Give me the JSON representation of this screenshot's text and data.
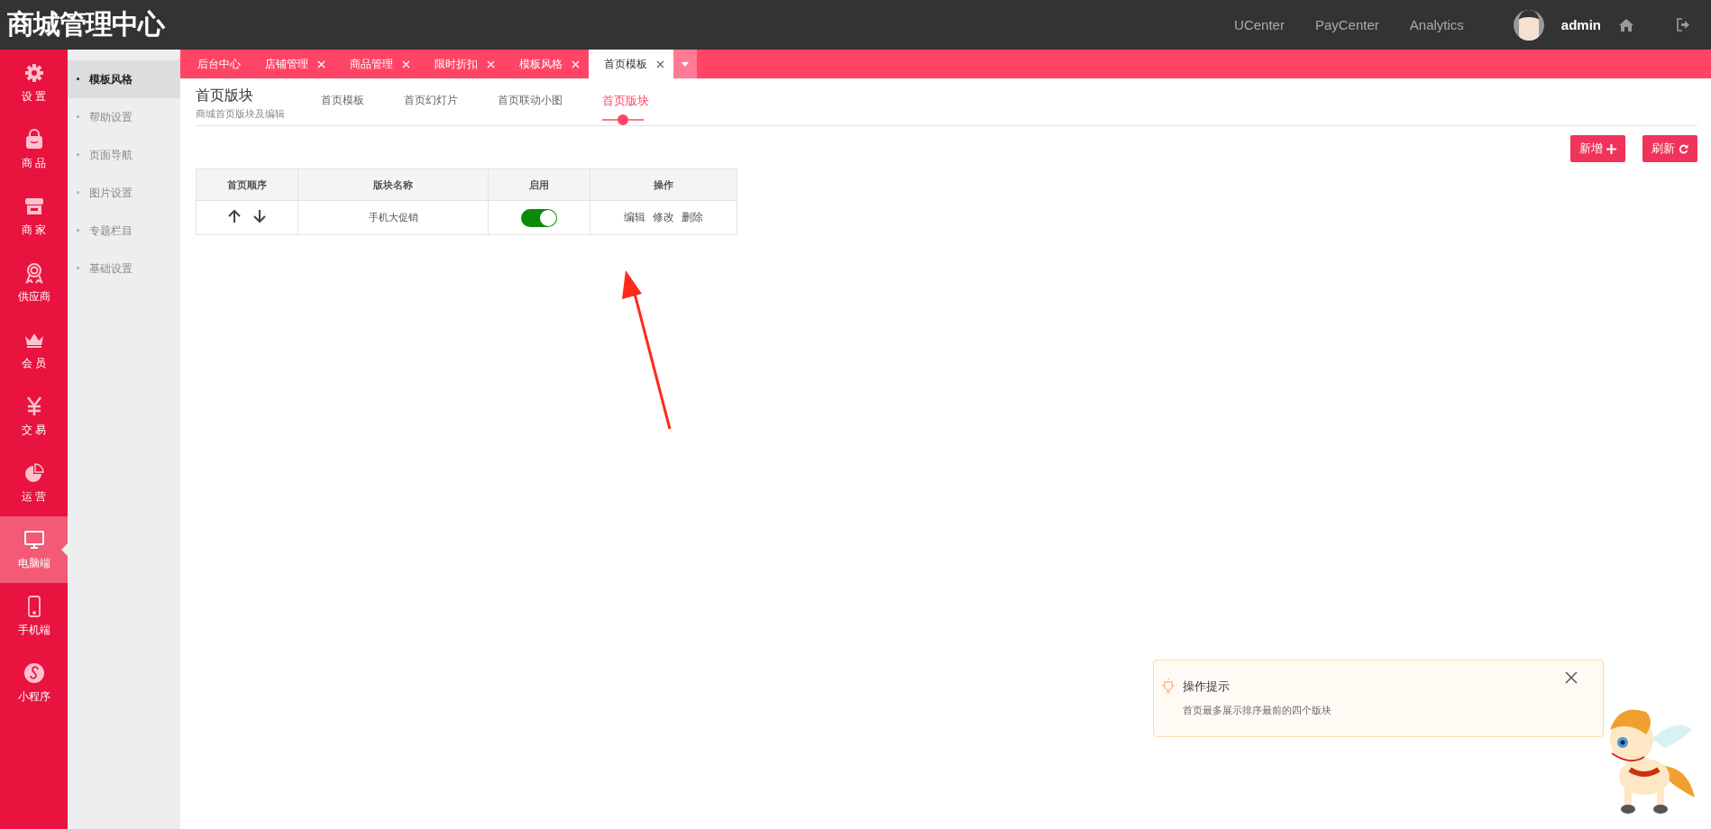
{
  "header": {
    "title": "商城管理中心",
    "links": [
      "UCenter",
      "PayCenter",
      "Analytics"
    ],
    "user": "admin"
  },
  "rail": [
    {
      "label": "设 置",
      "selected": false
    },
    {
      "label": "商 品",
      "selected": false
    },
    {
      "label": "商 家",
      "selected": false
    },
    {
      "label": "供应商",
      "selected": false
    },
    {
      "label": "会 员",
      "selected": false
    },
    {
      "label": "交 易",
      "selected": false
    },
    {
      "label": "运 营",
      "selected": false
    },
    {
      "label": "电脑端",
      "selected": true
    },
    {
      "label": "手机端",
      "selected": false
    },
    {
      "label": "小程序",
      "selected": false
    }
  ],
  "submenu": [
    {
      "label": "模板风格",
      "selected": true
    },
    {
      "label": "帮助设置",
      "selected": false
    },
    {
      "label": "页面导航",
      "selected": false
    },
    {
      "label": "图片设置",
      "selected": false
    },
    {
      "label": "专题栏目",
      "selected": false
    },
    {
      "label": "基础设置",
      "selected": false
    }
  ],
  "tabs": [
    {
      "label": "后台中心",
      "closable": false,
      "selected": false
    },
    {
      "label": "店铺管理",
      "closable": true,
      "selected": false
    },
    {
      "label": "商品管理",
      "closable": true,
      "selected": false
    },
    {
      "label": "限时折扣",
      "closable": true,
      "selected": false
    },
    {
      "label": "模板风格",
      "closable": true,
      "selected": false
    },
    {
      "label": "首页模板",
      "closable": true,
      "selected": true
    }
  ],
  "page": {
    "title": "首页版块",
    "subtitle": "商城首页版块及编辑",
    "subtabs": [
      {
        "label": "首页模板",
        "selected": false
      },
      {
        "label": "首页幻灯片",
        "selected": false
      },
      {
        "label": "首页联动小图",
        "selected": false
      },
      {
        "label": "首页版块",
        "selected": true
      }
    ],
    "buttons": [
      "新增",
      "刷新"
    ]
  },
  "table": {
    "columns": [
      "首页顺序",
      "版块名称",
      "启用",
      "操作"
    ],
    "rows": [
      {
        "name": "手机大促销",
        "enabled": true,
        "actions": [
          "编辑",
          "修改",
          "删除"
        ]
      }
    ]
  },
  "tip": {
    "title": "操作提示",
    "text": "首页最多展示排序最前的四个版块"
  }
}
